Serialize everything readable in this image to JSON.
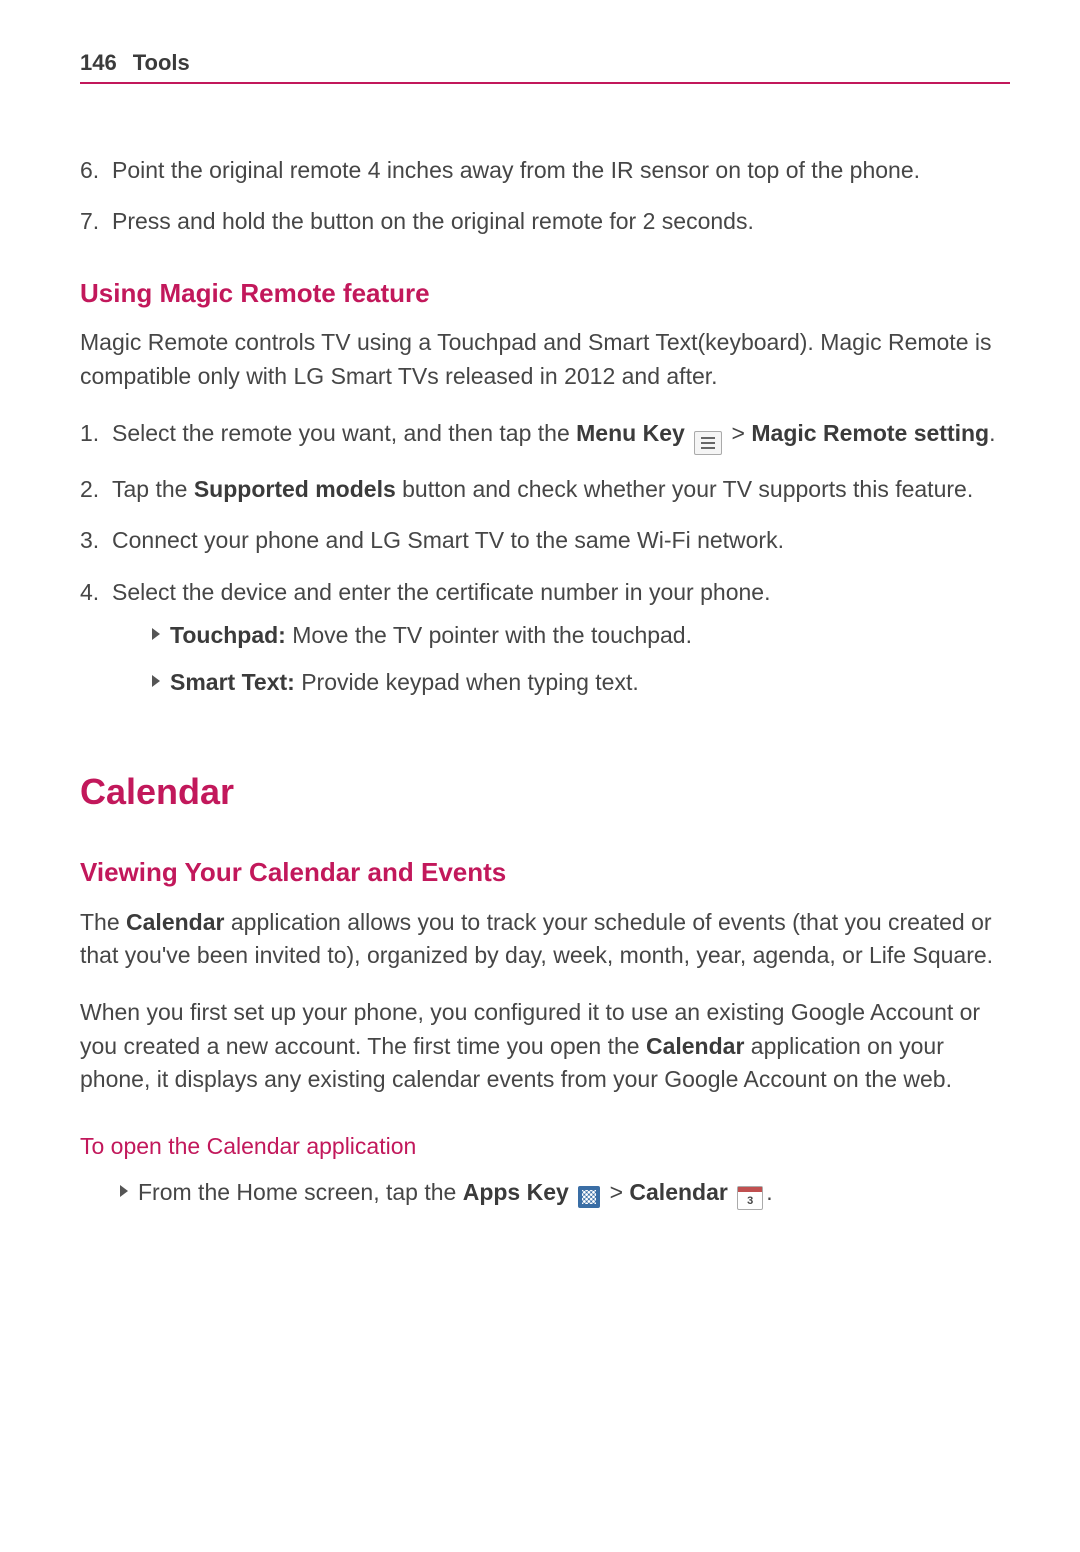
{
  "header": {
    "page_number": "146",
    "section": "Tools"
  },
  "list_top": {
    "item6": {
      "n": "6.",
      "text": "Point the original remote 4 inches away from the IR sensor on top of the phone."
    },
    "item7": {
      "n": "7.",
      "text": "Press and hold the button on the original remote for 2 seconds."
    }
  },
  "magic": {
    "heading": "Using Magic Remote feature",
    "intro": "Magic Remote controls TV using a Touchpad and Smart Text(keyboard). Magic Remote is compatible only with LG Smart TVs released in 2012 and after.",
    "step1": {
      "n": "1.",
      "pre": "Select the remote you want, and then tap the ",
      "menu_key": "Menu Key",
      "gt": " > ",
      "magic_remote": "Magic Remote setting",
      "post": "."
    },
    "step2": {
      "n": "2.",
      "pre": "Tap the ",
      "supported": "Supported models",
      "post": " button and check whether your TV supports this feature."
    },
    "step3": {
      "n": "3.",
      "text": "Connect your phone and LG Smart TV to the same Wi-Fi network."
    },
    "step4": {
      "n": "4.",
      "text": "Select the device and enter the certificate number in your phone."
    },
    "touchpad_label": "Touchpad:",
    "touchpad_text": " Move the TV pointer with the touchpad.",
    "smarttext_label": "Smart Text:",
    "smarttext_text": " Provide keypad when typing text."
  },
  "calendar": {
    "heading": "Calendar",
    "sub1": "Viewing Your Calendar and Events",
    "p1_pre": "The ",
    "p1_bold": "Calendar",
    "p1_post": " application allows you to track your schedule of events (that you created or that you've been invited to), organized by day, week, month, year, agenda, or Life Square.",
    "p2_pre": "When you first set up your phone, you configured it to use an existing Google Account or you created a new account. The first time you open the ",
    "p2_bold": "Calendar",
    "p2_post": " application on your phone, it displays any existing calendar events from your Google Account on the web.",
    "sub2": "To open the Calendar application",
    "open_pre": "From the Home screen, tap the ",
    "apps_key": "Apps Key",
    "gt": " > ",
    "calendar_label": "Calendar",
    "cal_day": "3",
    "period": "."
  }
}
